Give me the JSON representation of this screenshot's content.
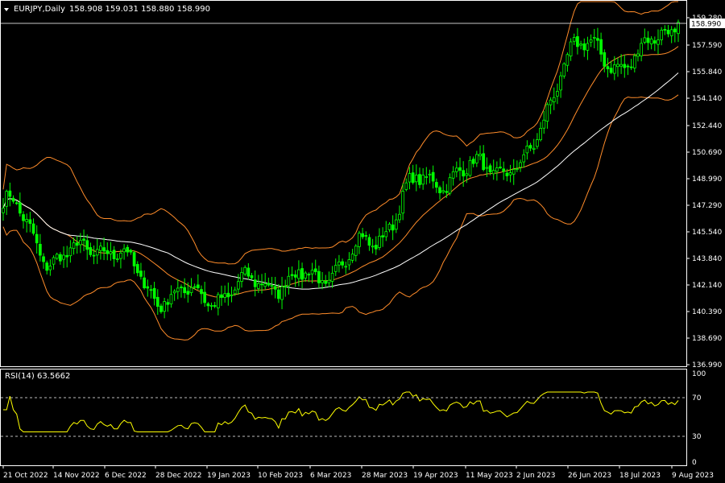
{
  "header": {
    "symbol": "EURJPY,Daily",
    "ohlc": "158.908 159.031 158.880 158.990"
  },
  "rsi_panel": {
    "label": "RSI(14) 63.5662",
    "levels": [
      "100",
      "70",
      "30",
      "0"
    ]
  },
  "price_axis": {
    "ticks": [
      "159.280",
      "157.590",
      "155.840",
      "154.140",
      "152.440",
      "150.690",
      "148.990",
      "147.290",
      "145.540",
      "143.840",
      "142.140",
      "140.390",
      "138.690",
      "136.990"
    ],
    "current_price": "158.990"
  },
  "time_axis": {
    "labels": [
      "21 Oct 2022",
      "14 Nov 2022",
      "6 Dec 2022",
      "28 Dec 2022",
      "19 Jan 2023",
      "10 Feb 2023",
      "6 Mar 2023",
      "28 Mar 2023",
      "19 Apr 2023",
      "11 May 2023",
      "2 Jun 2023",
      "26 Jun 2023",
      "18 Jul 2023",
      "9 Aug 2023"
    ]
  },
  "colors": {
    "background": "#000000",
    "candle": "#00ff00",
    "bollinger": "#ff8c2a",
    "moving_average": "#ffffff",
    "rsi_line": "#ffff00",
    "axis": "#ffffff",
    "level_dash": "#bbbbbb"
  },
  "chart_data": {
    "type": "line",
    "title": "EURJPY,Daily",
    "x": [
      "21 Oct 2022",
      "14 Nov 2022",
      "6 Dec 2022",
      "28 Dec 2022",
      "19 Jan 2023",
      "10 Feb 2023",
      "6 Mar 2023",
      "28 Mar 2023",
      "19 Apr 2023",
      "11 May 2023",
      "2 Jun 2023",
      "26 Jun 2023",
      "18 Jul 2023",
      "9 Aug 2023"
    ],
    "ylim": [
      136.99,
      159.28
    ],
    "series": [
      {
        "values": [
          147.4,
          143.8,
          144.6,
          141.5,
          141.4,
          142.3,
          142.5,
          144.6,
          148.6,
          149.5,
          149.8,
          157.4,
          156.4,
          158.99
        ]
      }
    ]
  }
}
